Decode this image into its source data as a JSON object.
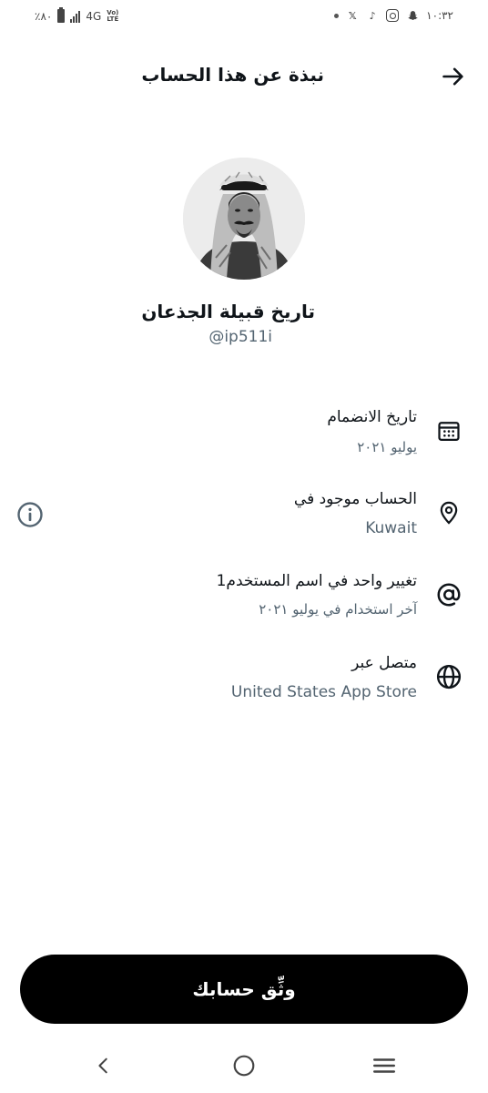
{
  "status_bar": {
    "time": "١٠:٣٢",
    "battery": "٪٨٠",
    "network": "4G",
    "vol_lte_top": "Vo)",
    "vol_lte_bottom": "LTE"
  },
  "header": {
    "title": "نبذة عن هذا الحساب"
  },
  "profile": {
    "display_name": "تاريخ قبيلة الجذعان",
    "handle": "@ip511i"
  },
  "rows": [
    {
      "title": "تاريخ الانضمام",
      "subtitle": "يوليو ٢٠٢١",
      "icon": "calendar-icon"
    },
    {
      "title": "الحساب موجود في",
      "subtitle": "Kuwait",
      "icon": "location-pin-icon"
    },
    {
      "title": "تغيير واحد في اسم المستخدم1",
      "subtitle": "آخر استخدام في يوليو ٢٠٢١",
      "icon": "at-sign-icon"
    },
    {
      "title": "متصل عبر",
      "subtitle": "United States App Store",
      "icon": "globe-icon"
    }
  ],
  "verify_button": {
    "label": "وثِّق حسابك"
  },
  "colors": {
    "primary_text": "#0f1419",
    "secondary_text": "#536471",
    "button_bg": "#000000"
  }
}
